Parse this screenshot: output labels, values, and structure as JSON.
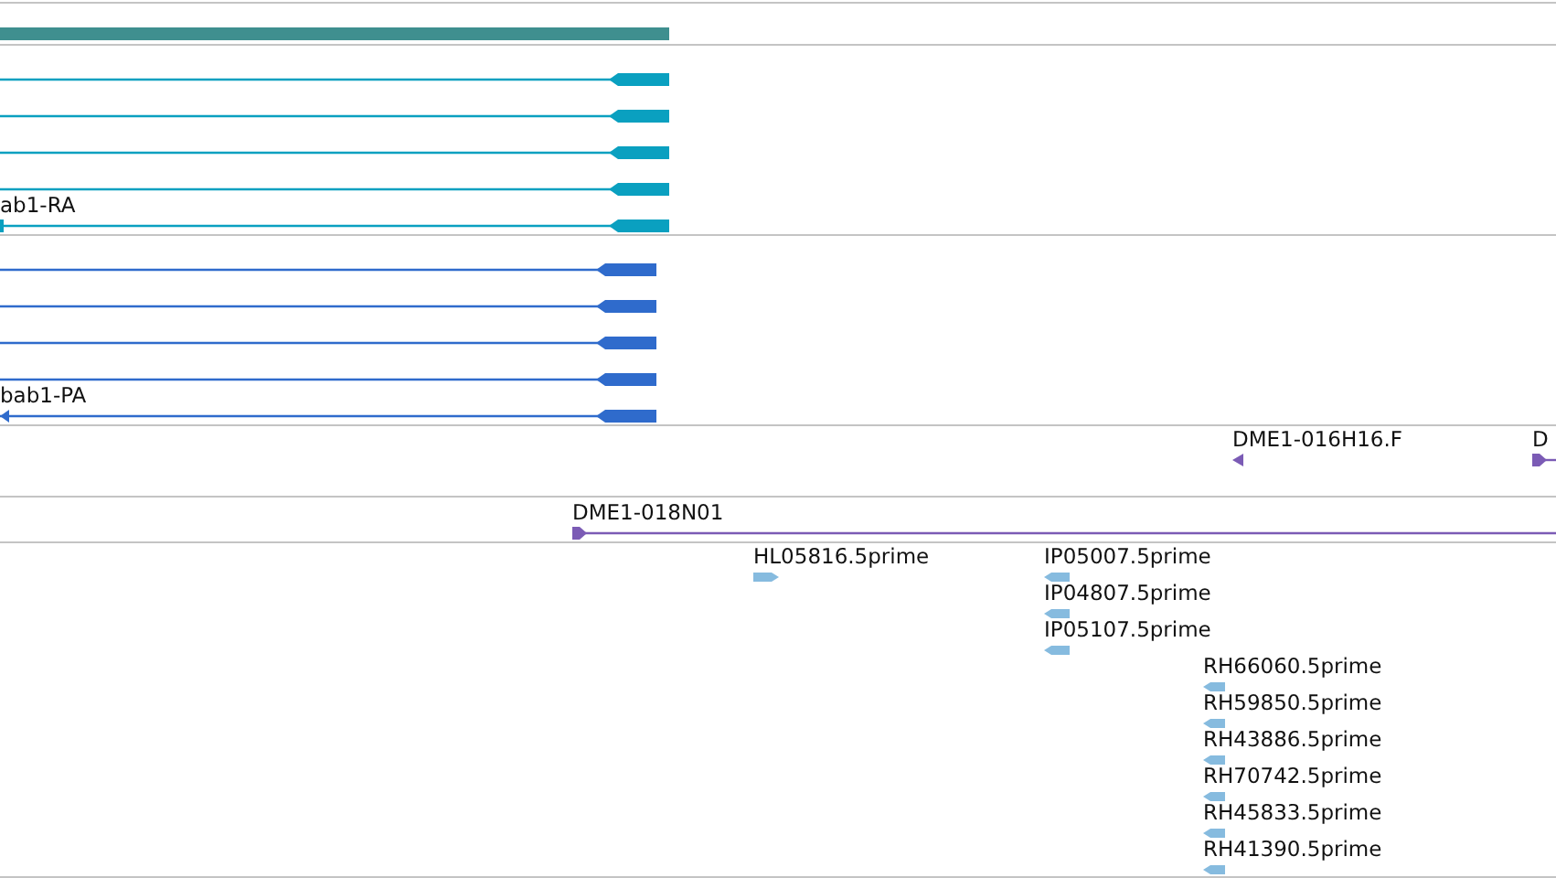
{
  "tracks": [
    {
      "color": "#3f8f8f",
      "features": [
        {
          "kind": "bar"
        }
      ]
    },
    {
      "color": "#0aa0c0",
      "features": [
        {
          "kind": "transcript",
          "reverse": true
        },
        {
          "kind": "transcript",
          "reverse": true
        },
        {
          "kind": "transcript",
          "reverse": true
        },
        {
          "kind": "transcript",
          "reverse": true
        },
        {
          "kind": "transcript",
          "reverse": true,
          "label": "ab1-RA"
        }
      ]
    },
    {
      "color": "#2f6bcc",
      "features": [
        {
          "kind": "transcript",
          "reverse": true
        },
        {
          "kind": "transcript",
          "reverse": true
        },
        {
          "kind": "transcript",
          "reverse": true
        },
        {
          "kind": "transcript",
          "reverse": true
        },
        {
          "kind": "transcript",
          "reverse": true,
          "label": "bab1-PA"
        }
      ]
    },
    {
      "color": "#7b5bb5",
      "features": [
        {
          "kind": "clone",
          "reverse": true,
          "label": "DME1-016H16.F"
        },
        {
          "kind": "clone",
          "reverse": false,
          "label": "D"
        }
      ]
    },
    {
      "color": "#7b5bb5",
      "features": [
        {
          "kind": "clone",
          "reverse": false,
          "label": "DME1-018N01"
        }
      ]
    },
    {
      "color": "#86bbdf",
      "features": [
        {
          "kind": "est",
          "reverse": false,
          "label": "HL05816.5prime"
        },
        {
          "kind": "est",
          "reverse": true,
          "label": "IP05007.5prime"
        },
        {
          "kind": "est",
          "reverse": true,
          "label": "IP04807.5prime"
        },
        {
          "kind": "est",
          "reverse": true,
          "label": "IP05107.5prime"
        },
        {
          "kind": "est",
          "reverse": true,
          "label": "RH66060.5prime"
        },
        {
          "kind": "est",
          "reverse": true,
          "label": "RH59850.5prime"
        },
        {
          "kind": "est",
          "reverse": true,
          "label": "RH43886.5prime"
        },
        {
          "kind": "est",
          "reverse": true,
          "label": "RH70742.5prime"
        },
        {
          "kind": "est",
          "reverse": true,
          "label": "RH45833.5prime"
        },
        {
          "kind": "est",
          "reverse": true,
          "label": "RH41390.5prime"
        }
      ]
    }
  ]
}
